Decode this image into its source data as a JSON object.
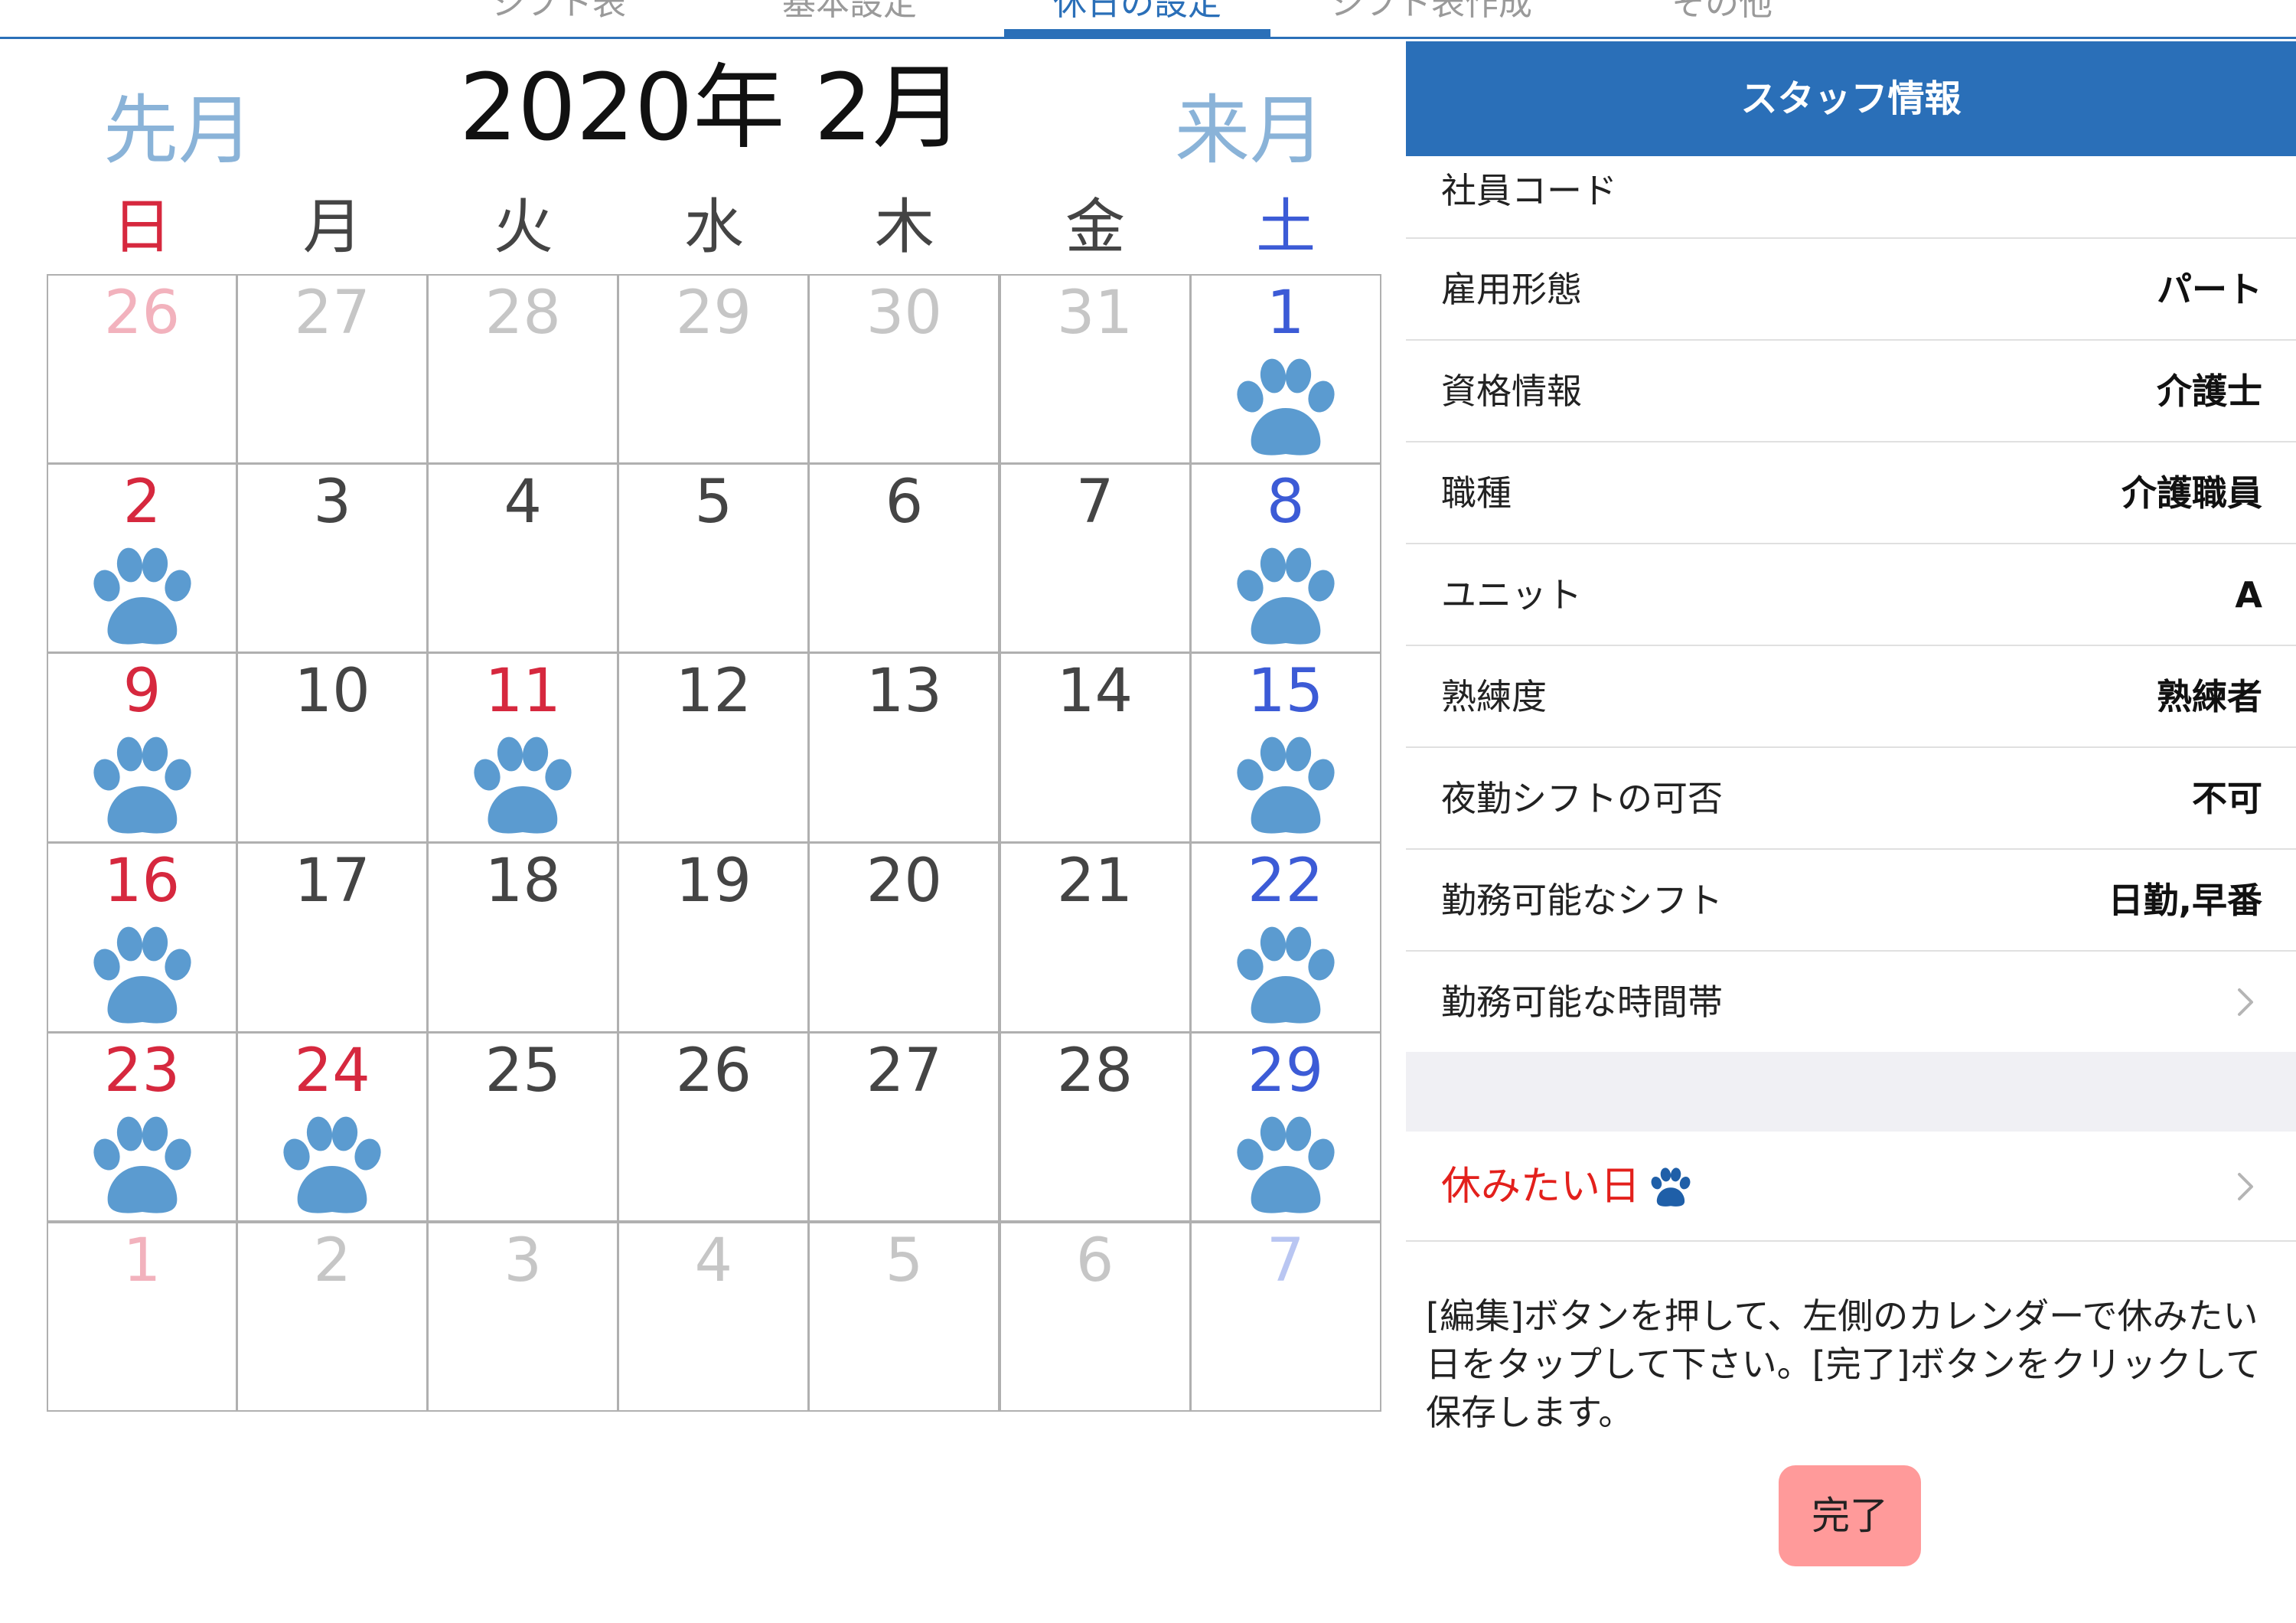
{
  "tabs": [
    {
      "label": "シフト表",
      "active": false
    },
    {
      "label": "基本設定",
      "active": false
    },
    {
      "label": "休日の設定",
      "active": true
    },
    {
      "label": "シフト表作成",
      "active": false
    },
    {
      "label": "その他",
      "active": false
    }
  ],
  "calendar": {
    "prev_label": "先月",
    "title": "2020年 2月",
    "next_label": "来月",
    "weekdays": [
      "日",
      "月",
      "火",
      "水",
      "木",
      "金",
      "土"
    ],
    "colors": {
      "sunday": "#d6283e",
      "saturday": "#3c5bd6",
      "weekday": "#444444",
      "other_month_sunday": "#f2b2bd",
      "other_month_saturday": "#b9c6f2",
      "other_month_weekday": "#c6c6c6",
      "paw": "#5b9bd0"
    },
    "weeks": [
      [
        {
          "day": "26",
          "other": true,
          "paw": false
        },
        {
          "day": "27",
          "other": true,
          "paw": false
        },
        {
          "day": "28",
          "other": true,
          "paw": false
        },
        {
          "day": "29",
          "other": true,
          "paw": false
        },
        {
          "day": "30",
          "other": true,
          "paw": false
        },
        {
          "day": "31",
          "other": true,
          "paw": false
        },
        {
          "day": "1",
          "other": false,
          "paw": true
        }
      ],
      [
        {
          "day": "2",
          "other": false,
          "paw": true
        },
        {
          "day": "3",
          "other": false,
          "paw": false
        },
        {
          "day": "4",
          "other": false,
          "paw": false
        },
        {
          "day": "5",
          "other": false,
          "paw": false
        },
        {
          "day": "6",
          "other": false,
          "paw": false
        },
        {
          "day": "7",
          "other": false,
          "paw": false
        },
        {
          "day": "8",
          "other": false,
          "paw": true
        }
      ],
      [
        {
          "day": "9",
          "other": false,
          "paw": true
        },
        {
          "day": "10",
          "other": false,
          "paw": false
        },
        {
          "day": "11",
          "other": false,
          "paw": true
        },
        {
          "day": "12",
          "other": false,
          "paw": false
        },
        {
          "day": "13",
          "other": false,
          "paw": false
        },
        {
          "day": "14",
          "other": false,
          "paw": false
        },
        {
          "day": "15",
          "other": false,
          "paw": true
        }
      ],
      [
        {
          "day": "16",
          "other": false,
          "paw": true
        },
        {
          "day": "17",
          "other": false,
          "paw": false
        },
        {
          "day": "18",
          "other": false,
          "paw": false
        },
        {
          "day": "19",
          "other": false,
          "paw": false
        },
        {
          "day": "20",
          "other": false,
          "paw": false
        },
        {
          "day": "21",
          "other": false,
          "paw": false
        },
        {
          "day": "22",
          "other": false,
          "paw": true
        }
      ],
      [
        {
          "day": "23",
          "other": false,
          "paw": true
        },
        {
          "day": "24",
          "other": false,
          "paw": true
        },
        {
          "day": "25",
          "other": false,
          "paw": false
        },
        {
          "day": "26",
          "other": false,
          "paw": false
        },
        {
          "day": "27",
          "other": false,
          "paw": false
        },
        {
          "day": "28",
          "other": false,
          "paw": false
        },
        {
          "day": "29",
          "other": false,
          "paw": true
        }
      ],
      [
        {
          "day": "1",
          "other": true,
          "paw": false
        },
        {
          "day": "2",
          "other": true,
          "paw": false
        },
        {
          "day": "3",
          "other": true,
          "paw": false
        },
        {
          "day": "4",
          "other": true,
          "paw": false
        },
        {
          "day": "5",
          "other": true,
          "paw": false
        },
        {
          "day": "6",
          "other": true,
          "paw": false
        },
        {
          "day": "7",
          "other": true,
          "paw": false
        }
      ]
    ]
  },
  "staff": {
    "header": "スタッフ情報",
    "rows": [
      {
        "label": "社員コード",
        "value": "",
        "chevron": false
      },
      {
        "label": "雇用形態",
        "value": "パート",
        "chevron": false
      },
      {
        "label": "資格情報",
        "value": "介護士",
        "chevron": false
      },
      {
        "label": "職種",
        "value": "介護職員",
        "chevron": false
      },
      {
        "label": "ユニット",
        "value": "A",
        "chevron": false
      },
      {
        "label": "熟練度",
        "value": "熟練者",
        "chevron": false
      },
      {
        "label": "夜勤シフトの可否",
        "value": "不可",
        "chevron": false
      },
      {
        "label": "勤務可能なシフト",
        "value": "日勤,早番",
        "chevron": false
      },
      {
        "label": "勤務可能な時間帯",
        "value": "",
        "chevron": true
      }
    ],
    "rest_days_label": "休みたい日",
    "rest_days_color": "#e3201c",
    "instructions": "[編集]ボタンを押して、左側のカレンダーで休みたい日をタップして下さい。[完了]ボタンをクリックして保存します。",
    "done_button": "完了",
    "header_color": "#2a6fb8",
    "done_button_color": "#ff9a9a"
  }
}
